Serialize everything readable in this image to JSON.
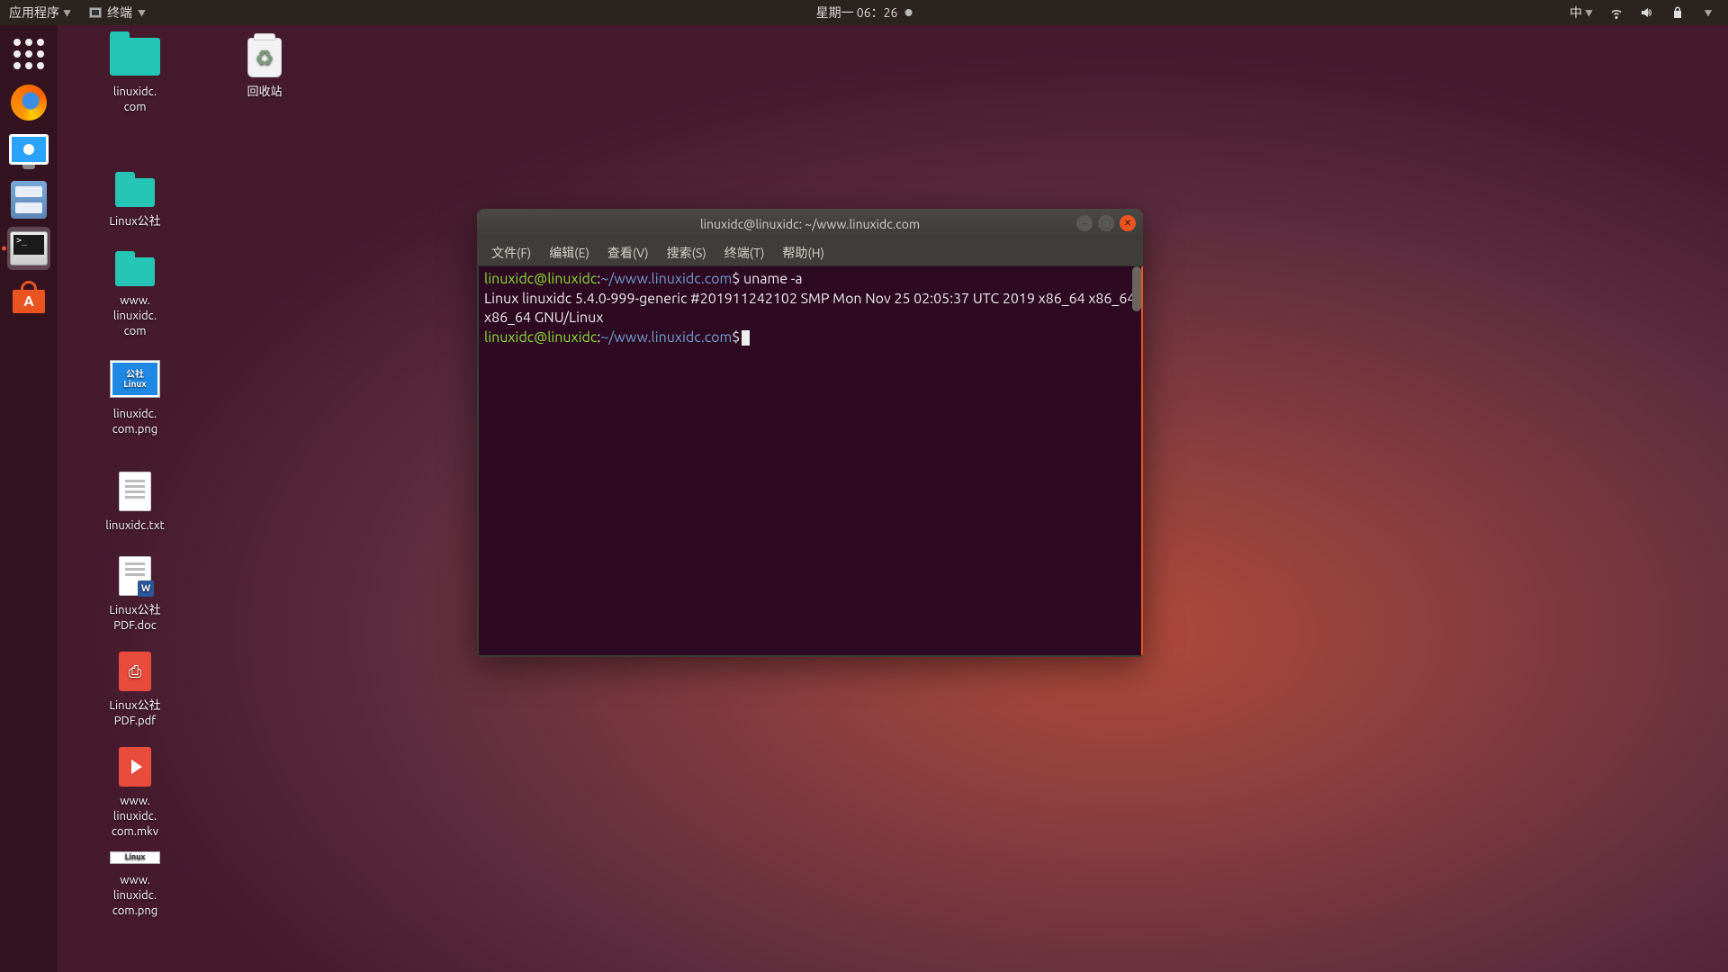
{
  "topbar": {
    "applications": "应用程序",
    "active_app": "终端",
    "datetime": "星期一 06：26",
    "ime": "中"
  },
  "desktop_icons": {
    "trash": "回收站",
    "folder1": "linuxidc.\ncom",
    "folder2": "Linux公社",
    "folder3": "www.\nlinuxidc.\ncom",
    "png1": "linuxidc.\ncom.png",
    "png1_thumb": "公社\nLinux",
    "txt": "linuxidc.txt",
    "doc": "Linux公社\nPDF.doc",
    "pdf": "Linux公社\nPDF.pdf",
    "mkv": "www.\nlinuxidc.\ncom.mkv",
    "png2": "www.\nlinuxidc.\ncom.png",
    "png2_thumb": "Linux"
  },
  "terminal": {
    "title": "linuxidc@linuxidc: ~/www.linuxidc.com",
    "menu": {
      "file": "文件(F)",
      "edit": "编辑(E)",
      "view": "查看(V)",
      "search": "搜索(S)",
      "terminal": "终端(T)",
      "help": "帮助(H)"
    },
    "prompt_user": "linuxidc@linuxidc",
    "prompt_sep": ":",
    "prompt_path": "~/www.linuxidc.com",
    "prompt_dollar": "$",
    "cmd1": " uname -a",
    "output": "Linux linuxidc 5.4.0-999-generic #201911242102 SMP Mon Nov 25 02:05:37 UTC 2019 x86_64 x86_64 x86_64 GNU/Linux"
  }
}
